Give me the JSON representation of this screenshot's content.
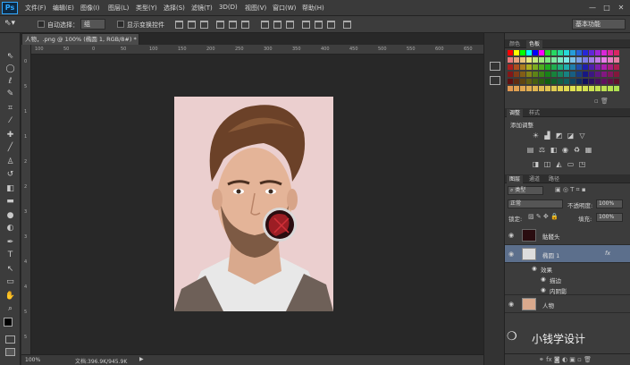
{
  "app": {
    "logo": "Ps"
  },
  "menu": [
    "文件(F)",
    "编辑(E)",
    "图像(I)",
    "图层(L)",
    "类型(Y)",
    "选择(S)",
    "滤镜(T)",
    "3D(D)",
    "视图(V)",
    "窗口(W)",
    "帮助(H)"
  ],
  "window_buttons": [
    "—",
    "□",
    "✕"
  ],
  "options_bar": {
    "auto_select_label": "自动选择：",
    "auto_select_value": "组",
    "show_transform_label": "显示变换控件",
    "workspace": "基本功能"
  },
  "document": {
    "tab_title": "人物，.png @ 100% (椭圆 1, RGB/8#) *"
  },
  "rulers": {
    "h": [
      "100",
      "50",
      "0",
      "50",
      "100",
      "150",
      "200",
      "250",
      "300",
      "350",
      "400",
      "450",
      "500",
      "550",
      "600",
      "650"
    ],
    "v": [
      "0",
      "5",
      "1",
      "1",
      "2",
      "2",
      "3",
      "3",
      "4",
      "4",
      "5",
      "5"
    ]
  },
  "status": {
    "zoom": "100%",
    "doc": "文档:396.9K/945.9K"
  },
  "panels": {
    "color_tabs": [
      "颜色",
      "色板"
    ],
    "adjust_tabs": [
      "调整",
      "样式"
    ],
    "adjust_title": "添加调整",
    "layer_tabs": [
      "图层",
      "通道",
      "路径"
    ],
    "filter_kind": "类型",
    "blend_mode": "正常",
    "opacity_label": "不透明度:",
    "opacity_value": "100%",
    "lock_label": "锁定:",
    "fill_label": "填充:",
    "fill_value": "100%"
  },
  "layers": [
    {
      "name": "骷髅头",
      "selected": false
    },
    {
      "name": "椭圆 1",
      "selected": true,
      "fx": "fx"
    },
    {
      "name": "效果",
      "effect": true
    },
    {
      "name": "描边",
      "effect": true
    },
    {
      "name": "内阴影",
      "effect": true
    },
    {
      "name": "人物",
      "selected": false
    }
  ],
  "watermark": "小钱学设计",
  "colors": {
    "accent": "#31a8ff",
    "selected_layer": "#5c6f8c",
    "panel": "#3c3c3c"
  }
}
